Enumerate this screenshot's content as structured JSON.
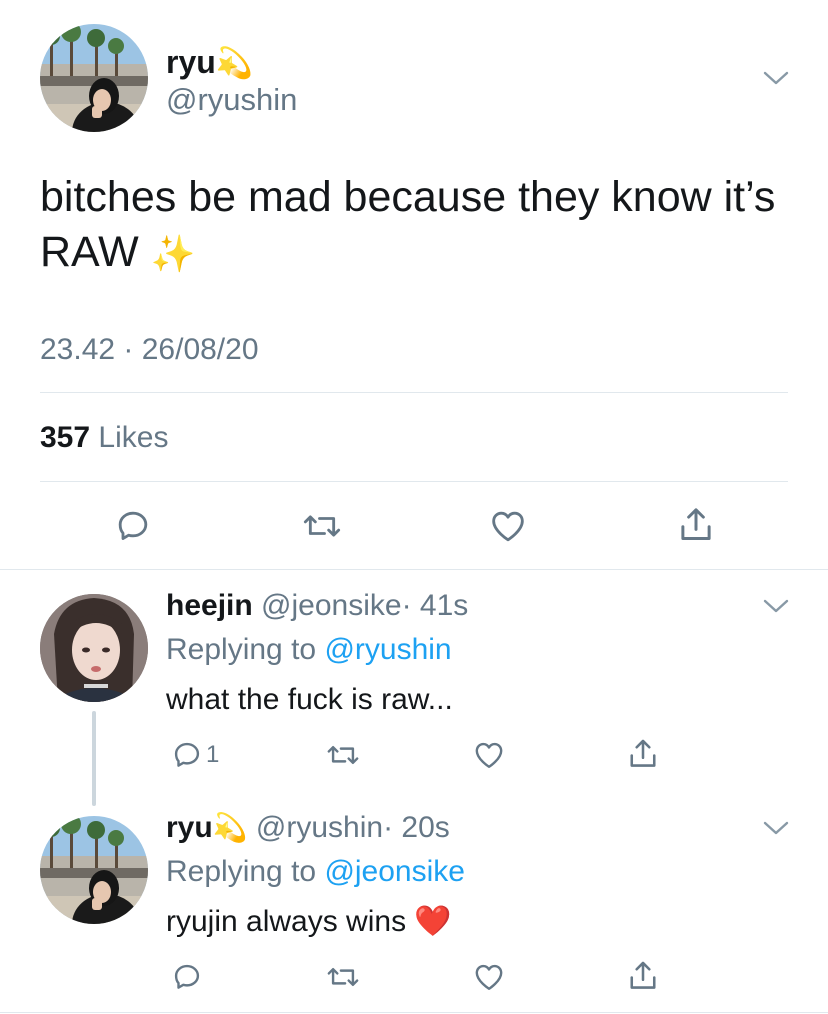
{
  "main_tweet": {
    "display_name": "ryu",
    "name_emoji": "💫",
    "handle": "@ryushin",
    "text_line1": "bitches be mad because they know it’s",
    "text_line2": "RAW",
    "text_emoji": "✨",
    "timestamp": "23.42 · 26/08/20",
    "likes_count": "357",
    "likes_label": "Likes"
  },
  "replies": [
    {
      "display_name": "heejin",
      "name_emoji": "",
      "handle": "@jeonsike",
      "time": "· 41s",
      "replying_prefix": "Replying to",
      "replying_to": "@ryushin",
      "text": "what the fuck is raw...",
      "text_emoji": "",
      "reply_count": "1"
    },
    {
      "display_name": "ryu",
      "name_emoji": "💫",
      "handle": "@ryushin",
      "time": "· 20s",
      "replying_prefix": "Replying to",
      "replying_to": "@jeonsike",
      "text": "ryujin always wins",
      "text_emoji": "❤️",
      "reply_count": ""
    }
  ],
  "icons": {
    "reply": "reply-icon",
    "retweet": "retweet-icon",
    "like": "heart-icon",
    "share": "share-icon",
    "more": "chevron-down-icon"
  },
  "colors": {
    "text": "#14171a",
    "secondary": "#657786",
    "link": "#1da1f2",
    "divider": "#e1e8ed"
  }
}
